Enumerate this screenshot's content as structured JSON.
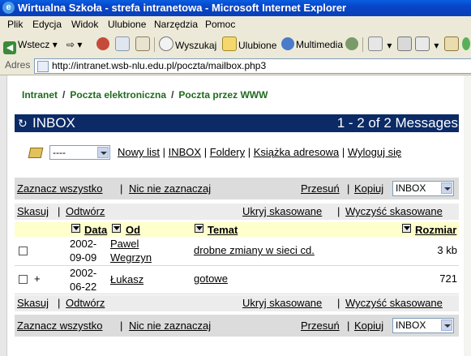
{
  "window": {
    "title": "Wirtualna Szkoła - strefa intranetowa - Microsoft Internet Explorer"
  },
  "menu": [
    "Plik",
    "Edycja",
    "Widok",
    "Ulubione",
    "Narzędzia",
    "Pomoc"
  ],
  "toolbar": {
    "back": "Wstecz",
    "search": "Wyszukaj",
    "favorites": "Ulubione",
    "multimedia": "Multimedia"
  },
  "address": {
    "label": "Adres",
    "url": "http://intranet.wsb-nlu.edu.pl/poczta/mailbox.php3"
  },
  "breadcrumb": [
    "Intranet",
    "Poczta elektroniczna",
    "Poczta przez WWW"
  ],
  "inbox": {
    "title": "INBOX",
    "count": "1 - 2 of 2 Messages"
  },
  "nav": {
    "select_value": "----",
    "links": [
      "Nowy list",
      "INBOX",
      "Foldery",
      "Książka adresowa",
      "Wyloguj się"
    ]
  },
  "select_bar": {
    "select_all": "Zaznacz wszystko",
    "select_none": "Nic nie zaznaczaj",
    "move": "Przesuń",
    "copy": "Kopiuj",
    "folder_value": "INBOX"
  },
  "action_bar": {
    "delete": "Skasuj",
    "undelete": "Odtwórz",
    "hide_deleted": "Ukryj skasowane",
    "expunge": "Wyczyść skasowane"
  },
  "columns": {
    "date": "Data",
    "from": "Od",
    "subject": "Temat",
    "size": "Rozmiar"
  },
  "messages": [
    {
      "flag": "",
      "date_line1": "2002-",
      "date_line2": "09-09",
      "from_line1": "Pawel",
      "from_line2": "Wegrzyn",
      "subject": "drobne zmiany w sieci cd.",
      "size": "3 kb"
    },
    {
      "flag": "+",
      "date_line1": "2002-",
      "date_line2": "06-22",
      "from_line1": "Łukasz",
      "from_line2": "",
      "subject": "gotowe",
      "size": "721"
    }
  ]
}
